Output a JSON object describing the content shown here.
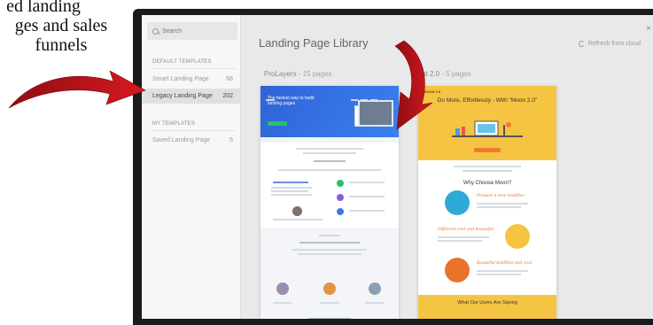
{
  "caption": {
    "line1": "ed landing",
    "line2": "ges and sales",
    "line3": "funnels"
  },
  "sidebar": {
    "search_placeholder": "Search",
    "sections": [
      {
        "title": "DEFAULT TEMPLATES",
        "items": [
          {
            "label": "Smart Landing Page",
            "count": "66"
          },
          {
            "label": "Legacy Landing Page",
            "count": "202"
          }
        ]
      },
      {
        "title": "MY TEMPLATES",
        "items": [
          {
            "label": "Saved Landing Page",
            "count": "5"
          }
        ]
      }
    ]
  },
  "main": {
    "title": "Landing Page Library",
    "refresh_label": "Refresh from cloud",
    "close_label": "×",
    "groups": [
      {
        "name": "ProLayers",
        "count": "15 pages"
      },
      {
        "name": "at 2.0",
        "count": "5 pages"
      }
    ]
  },
  "cards": {
    "prolayers": {
      "headline": "The fastest way to build landing pages"
    },
    "moon": {
      "logo": "MOON 2.0",
      "headline": "Do More, Effortlessly - With \"Moon 2.0\"",
      "why": "Why Choose Moon?",
      "script1": "Prepare a new landfiles",
      "script2": "Different cool and beautiful",
      "script3": "Beautiful landfiles and cool",
      "footer": "What Our Users Are Saying"
    }
  },
  "colors": {
    "arrow": "#c8161d",
    "prolayers_blue": "#2f63d6",
    "moon_yellow": "#f5c442"
  }
}
